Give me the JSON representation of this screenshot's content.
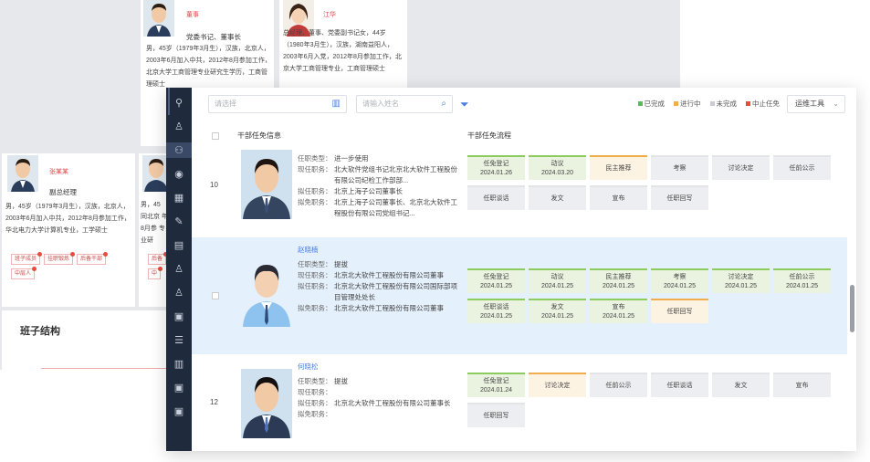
{
  "bg_cards": {
    "card1": {
      "name": "董事",
      "role": "党委书记、董事长",
      "bio": "男，45岁（1979年3月生），汉族，北京人，2003年6月加入中共，2012年8月参加工作，北京大学工商管理专业研究生学历，工商管理硕士"
    },
    "card2": {
      "name": "江华",
      "role": "总经理、董事、党委副书记",
      "bio": "女，44岁（1980年3月生），汉族，湖南益阳人，2003年6月入党，2012年8月参加工作，北京大学工商管理专业，工商管理硕士"
    },
    "card3": {
      "name": "张某某",
      "role": "副总经理",
      "bio": "男，45岁（1979年3月生），汉族，北京人，2003年6月加入中共，2012年8月参加工作，华北电力大学计算机专业，工学硕士",
      "tags": [
        "班子成员",
        "挂职锻炼",
        "后备干部",
        "中层人"
      ]
    },
    "card4": {
      "bio": "男，45 同北京 年8月参 专业研",
      "tags": [
        "后备",
        "中"
      ]
    }
  },
  "team_title": "班子结构",
  "toolbar": {
    "select_placeholder": "请选择",
    "name_placeholder": "请输入姓名",
    "tools_label": "运维工具",
    "legend": [
      {
        "label": "已完成",
        "color": "#5cb85c"
      },
      {
        "label": "进行中",
        "color": "#f0ad4e"
      },
      {
        "label": "未完成",
        "color": "#c9ccd1"
      },
      {
        "label": "中止任免",
        "color": "#e74c3c"
      }
    ]
  },
  "table": {
    "col_info": "干部任免信息",
    "col_flow": "干部任免流程",
    "rows": [
      {
        "num": "10",
        "name": "",
        "fields": [
          {
            "k": "任职类型：",
            "v": "进一步使用"
          },
          {
            "k": "现任职务：",
            "v": "北大软件党组书记北京北大软件工程股份有限公司纪检工作部部..."
          },
          {
            "k": "拟任职务：",
            "v": "北京上海子公司董事长"
          },
          {
            "k": "拟免职务：",
            "v": "北京上海子公司董事长、北京北大软件工程股份有限公司党组书记..."
          }
        ],
        "steps": [
          {
            "label": "任免登记",
            "date": "2024.01.26",
            "status": "done"
          },
          {
            "label": "动议",
            "date": "2024.03.20",
            "status": "done"
          },
          {
            "label": "民主推荐",
            "date": "",
            "status": "prog"
          },
          {
            "label": "考察",
            "date": "",
            "status": "todo"
          },
          {
            "label": "讨论决定",
            "date": "",
            "status": "todo"
          },
          {
            "label": "任前公示",
            "date": "",
            "status": "todo"
          },
          {
            "label": "任职谈话",
            "date": "",
            "status": "todo"
          },
          {
            "label": "发文",
            "date": "",
            "status": "todo"
          },
          {
            "label": "宣布",
            "date": "",
            "status": "todo"
          },
          {
            "label": "任职回写",
            "date": "",
            "status": "todo"
          }
        ]
      },
      {
        "num": "",
        "name": "赵晓楠",
        "fields": [
          {
            "k": "任职类型：",
            "v": "提拔"
          },
          {
            "k": "现任职务：",
            "v": "北京北大软件工程股份有限公司董事"
          },
          {
            "k": "拟任职务：",
            "v": "北京北大软件工程股份有限公司国际部项目管理处处长"
          },
          {
            "k": "拟免职务：",
            "v": "北京北大软件工程股份有限公司董事"
          }
        ],
        "steps": [
          {
            "label": "任免登记",
            "date": "2024.01.25",
            "status": "done"
          },
          {
            "label": "动议",
            "date": "2024.01.25",
            "status": "done"
          },
          {
            "label": "民主推荐",
            "date": "2024.01.25",
            "status": "done"
          },
          {
            "label": "考察",
            "date": "2024.01.25",
            "status": "done"
          },
          {
            "label": "讨论决定",
            "date": "2024.01.25",
            "status": "done"
          },
          {
            "label": "任前公示",
            "date": "2024.01.25",
            "status": "done"
          },
          {
            "label": "任职谈话",
            "date": "2024.01.25",
            "status": "done"
          },
          {
            "label": "发文",
            "date": "2024.01.25",
            "status": "done"
          },
          {
            "label": "宣布",
            "date": "2024.01.25",
            "status": "done"
          },
          {
            "label": "任职回写",
            "date": "",
            "status": "prog"
          }
        ]
      },
      {
        "num": "12",
        "name": "何晓松",
        "fields": [
          {
            "k": "任职类型：",
            "v": "提拔"
          },
          {
            "k": "现任职务：",
            "v": ""
          },
          {
            "k": "拟任职务：",
            "v": "北京北大软件工程股份有限公司董事长"
          },
          {
            "k": "拟免职务：",
            "v": ""
          }
        ],
        "steps": [
          {
            "label": "任免登记",
            "date": "2024.01.24",
            "status": "done"
          },
          {
            "label": "讨论决定",
            "date": "",
            "status": "prog"
          },
          {
            "label": "任前公示",
            "date": "",
            "status": "todo"
          },
          {
            "label": "任职谈话",
            "date": "",
            "status": "todo"
          },
          {
            "label": "发文",
            "date": "",
            "status": "todo"
          },
          {
            "label": "宣布",
            "date": "",
            "status": "todo"
          },
          {
            "label": "任职回写",
            "date": "",
            "status": "todo"
          }
        ]
      }
    ]
  }
}
